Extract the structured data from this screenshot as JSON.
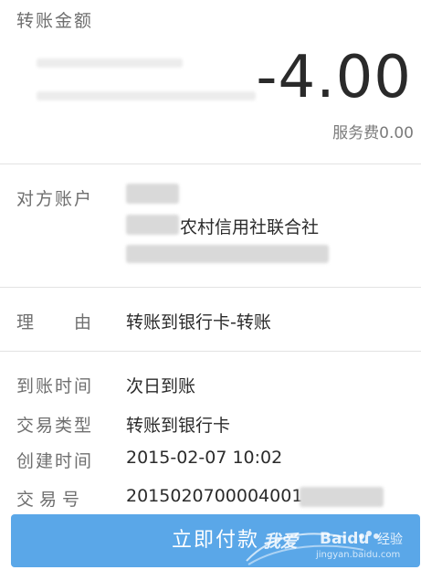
{
  "amount_section": {
    "label": "转账金额",
    "amount": "-4.00",
    "fee": "服务费0.00"
  },
  "payee_section": {
    "label": "对方账户",
    "bank_name": "农村信用社联合社"
  },
  "reason_section": {
    "label": "理　　由",
    "value": "转账到银行卡-转账"
  },
  "details": [
    {
      "label": "到账时间",
      "value": "次日到账"
    },
    {
      "label": "交易类型",
      "value": "转账到银行卡"
    },
    {
      "label": "创建时间",
      "value": "2015-02-07 10:02"
    },
    {
      "label": "交易号",
      "value": "2015020700004001"
    }
  ],
  "pay_button": {
    "label": "立即付款"
  },
  "watermark": {
    "text_cn": "我爱",
    "brand": "Baidu",
    "jingyan": "经验",
    "url": "jingyan.baidu.com"
  },
  "colors": {
    "pay_button_bg": "#5aa7e8",
    "label_gray": "#6f6f6f",
    "divider": "#e3e3e3"
  }
}
